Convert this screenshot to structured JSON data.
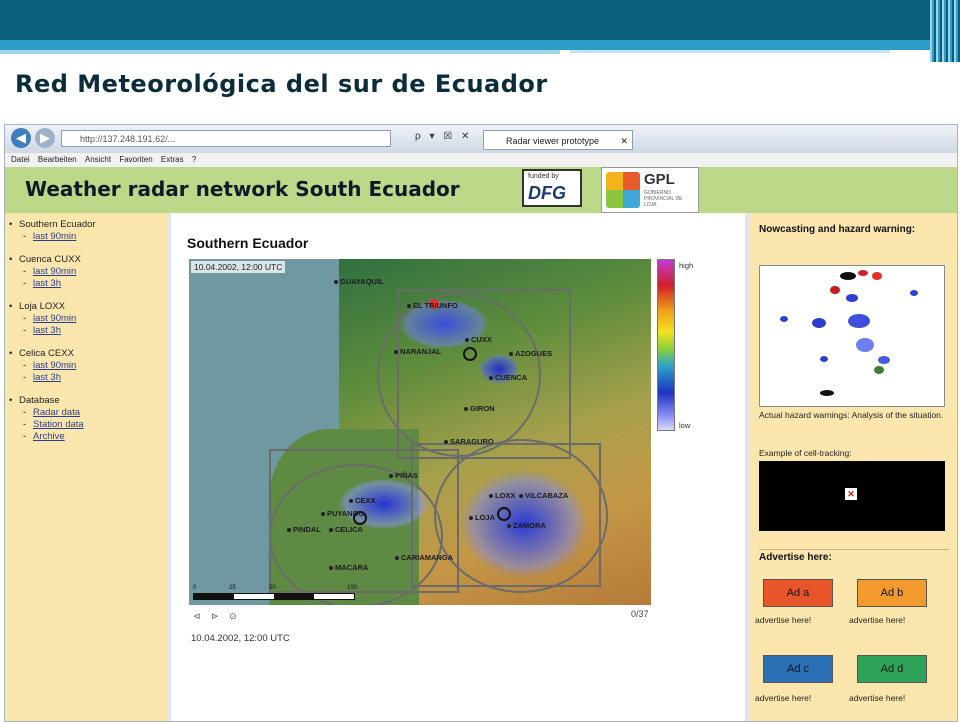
{
  "slide": {
    "title": "Red Meteorológica del sur de Ecuador"
  },
  "browser": {
    "address": "http://137.248.191.62/...",
    "tab_title": "Radar viewer prototype",
    "address_icons": "ρ ▾ ☒ ✕",
    "menu": [
      "Datei",
      "Bearbeiten",
      "Ansicht",
      "Favoriten",
      "Extras",
      "?"
    ]
  },
  "header": {
    "title": "Weather radar network South Ecuador",
    "dfg_small": "funded by",
    "dfg": "DFG",
    "gpl": "GPL",
    "gpl_sub": "GOBIERNO PROVINCIAL DE LOJA"
  },
  "sidebar": {
    "groups": [
      {
        "label": "Southern Ecuador",
        "items": [
          "last 90min"
        ]
      },
      {
        "label": "Cuenca CUXX",
        "items": [
          "last 90min",
          "last 3h"
        ]
      },
      {
        "label": "Loja LOXX",
        "items": [
          "last 90min",
          "last 3h"
        ]
      },
      {
        "label": "Celica CEXX",
        "items": [
          "last 90min",
          "last 3h"
        ]
      },
      {
        "label": "Database",
        "items": [
          "Radar data",
          "Station data",
          "Archive"
        ]
      }
    ]
  },
  "main": {
    "heading": "Southern Ecuador",
    "map_timestamp": "10.04.2002, 12:00 UTC",
    "legend_high": "high",
    "legend_low": "low",
    "scale_labels": [
      "0",
      "25",
      "50",
      "100"
    ],
    "controls": "⊲ ⊳ ⊙",
    "frame_counter": "0/37",
    "bottom_timestamp": "10.04.2002, 12:00 UTC",
    "cities": [
      "GUAYAQUIL",
      "EL TRIUNFO",
      "NARANJAL",
      "CUXX",
      "AZOGUES",
      "CUENCA",
      "GIRON",
      "SARAGURO",
      "PIÑAS",
      "CEXX",
      "PUYANGO",
      "PINDAL",
      "CELICA",
      "LOXX",
      "VILCABAZA",
      "LOJA",
      "ZAMORA",
      "CARIAMANGA",
      "MACARA"
    ]
  },
  "right": {
    "heading": "Nowcasting and hazard warning:",
    "caption": "Actual hazard warnings: Analysis of the situation.",
    "celltrack_caption": "Example of cell-tracking:",
    "advertise_heading": "Advertise here:",
    "ads": [
      {
        "label": "Ad a",
        "note": "advertise here!",
        "color": "#e8552a"
      },
      {
        "label": "Ad b",
        "note": "advertise here!",
        "color": "#f29a2e"
      },
      {
        "label": "Ad c",
        "note": "advertise here!",
        "color": "#2b6fb5"
      },
      {
        "label": "Ad d",
        "note": "advertise here!",
        "color": "#2fa35a"
      }
    ]
  }
}
